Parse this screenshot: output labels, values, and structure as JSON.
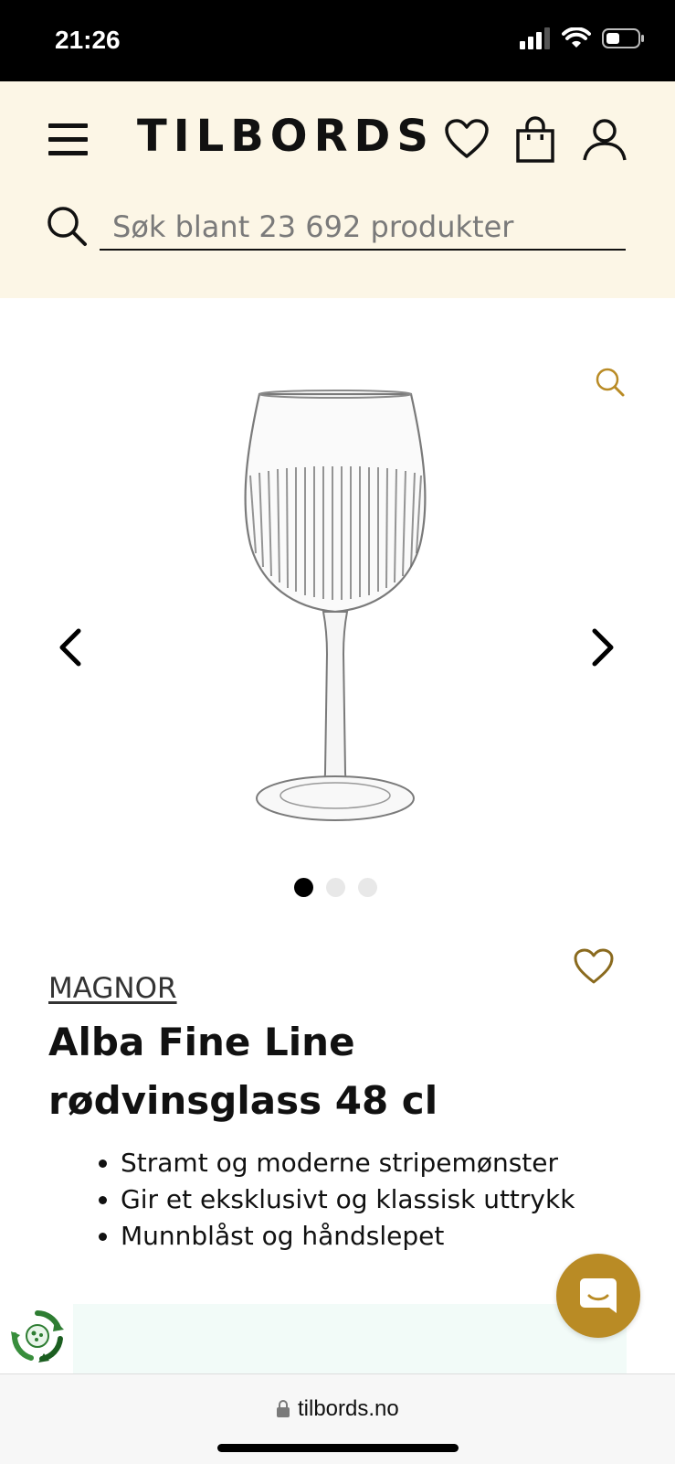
{
  "status": {
    "time": "21:26"
  },
  "header": {
    "logo": "TILBORDS",
    "search_placeholder": "Søk blant 23 692 produkter"
  },
  "gallery": {
    "image_alt": "Alba Fine Line rødvinsglass 48 cl",
    "dots_total": 3,
    "dot_active_index": 0
  },
  "product": {
    "brand": "MAGNOR",
    "title": "Alba Fine Line rødvinsglass 48 cl",
    "features": [
      "Stramt og moderne stripemønster",
      "Gir et eksklusivt og klassisk uttrykk",
      "Munnblåst og håndslepet"
    ]
  },
  "browser": {
    "url": "tilbords.no"
  },
  "colors": {
    "header_bg": "#fcf6e6",
    "accent_gold": "#b98b25",
    "banner_teal": "#f2fbf8"
  },
  "icons": {
    "menu": "hamburger-icon",
    "wishlist": "heart-icon",
    "cart": "shopping-bag-icon",
    "account": "user-icon",
    "search": "search-icon",
    "zoom": "zoom-icon",
    "prev": "chevron-left-icon",
    "next": "chevron-right-icon",
    "chat": "chat-icon",
    "eco": "recycle-badge-icon",
    "lock": "lock-icon"
  }
}
